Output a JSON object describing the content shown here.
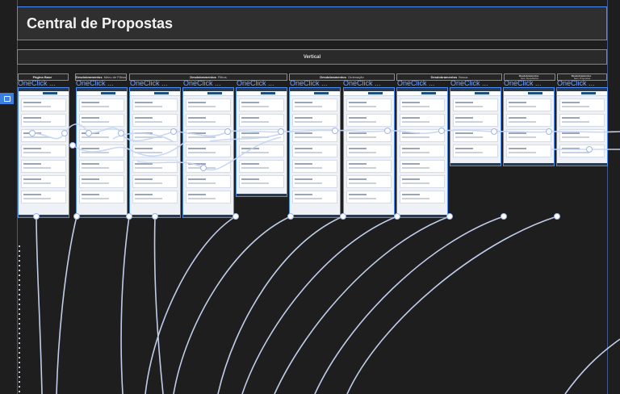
{
  "board": {
    "title": "Central de Propostas",
    "section_label": "Vertical",
    "frame_label": "OneClick ...",
    "groups": [
      {
        "strong": "Página Base",
        "sub": ""
      },
      {
        "strong": "Desdobramentos",
        "sub": "Menu de Filtros"
      },
      {
        "strong": "Desdobramentos",
        "sub": "Filtros"
      },
      {
        "strong": "Desdobramentos",
        "sub": "Ordenação"
      },
      {
        "strong": "Desdobramentos",
        "sub": "Busca"
      },
      {
        "strong": "Desdobramentos",
        "sub": "Sem Resultados"
      },
      {
        "strong": "Desdobramentos",
        "sub": "Sem Propostas"
      }
    ]
  },
  "colors": {
    "background": "#1e1e1e",
    "accent": "#4c8ef7",
    "wire": "#c8d6f5"
  }
}
